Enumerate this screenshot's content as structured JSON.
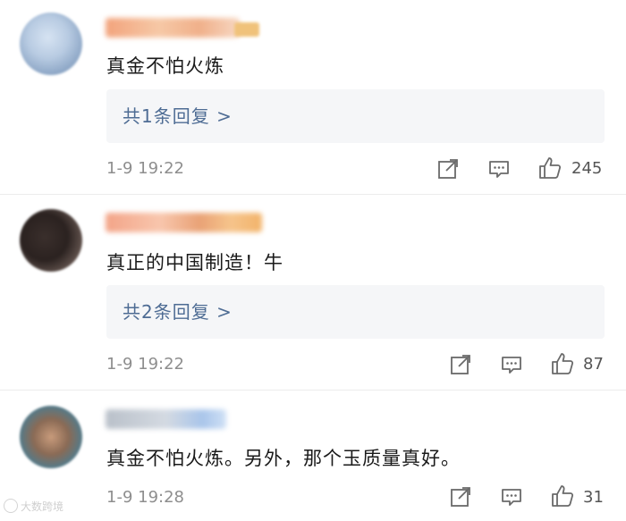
{
  "comments": [
    {
      "text": "真金不怕火炼",
      "reply_label": "共1条回复 >",
      "time": "1-9 19:22",
      "likes": "245"
    },
    {
      "text": "真正的中国制造！牛",
      "reply_label": "共2条回复 >",
      "time": "1-9 19:22",
      "likes": "87"
    },
    {
      "text": "真金不怕火炼。另外，那个玉质量真好。",
      "time": "1-9 19:28",
      "likes": "31"
    }
  ],
  "icons": {
    "share": "share-icon",
    "comment": "comment-icon",
    "like": "thumbs-up-icon"
  },
  "colors": {
    "reply_link": "#4e6c94",
    "reply_bg": "#f5f6f8",
    "meta_text": "#8e8e8e"
  },
  "watermark": "大数跨境"
}
